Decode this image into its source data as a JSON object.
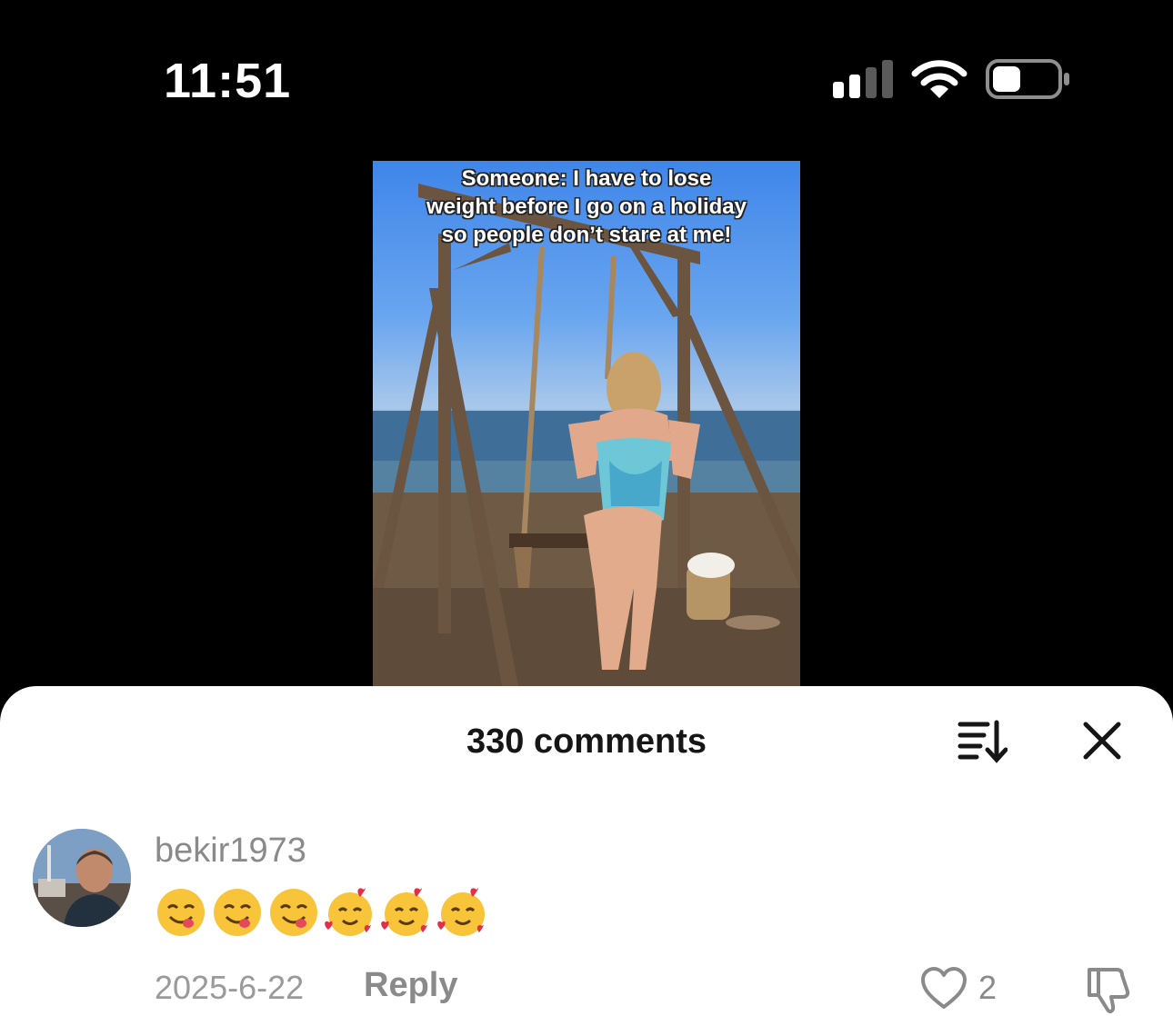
{
  "status_bar": {
    "time": "11:51",
    "signal_icon": "cellular-signal-icon",
    "wifi_icon": "wifi-icon",
    "battery_icon": "battery-icon"
  },
  "video": {
    "caption": "Someone: I have to lose\nweight before I go on a holiday\nso people don’t stare at me!"
  },
  "comments_sheet": {
    "title": "330 comments",
    "sort_icon": "sort-icon",
    "close_icon": "close-icon",
    "comments": [
      {
        "username": "bekir1973",
        "emojis": [
          "😋",
          "😋",
          "😋",
          "🥰",
          "🥰",
          "🥰"
        ],
        "date": "2025-6-22",
        "reply_label": "Reply",
        "like_count": "2"
      }
    ]
  },
  "colors": {
    "background": "#000000",
    "sheet": "#ffffff",
    "muted_text": "#8a8a8a"
  }
}
